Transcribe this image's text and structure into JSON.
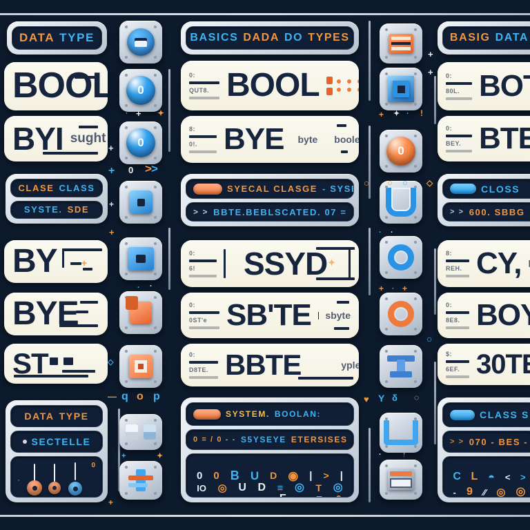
{
  "meta": {
    "background": "#0c1a2c",
    "accent_orange": "#f2973e",
    "accent_blue": "#3fb4f2",
    "plate_cream": "#faf8ee",
    "ink": "#16243d"
  },
  "columns": {
    "left": {
      "header": {
        "name": "data-type-header",
        "word1": "DATA",
        "word2": "TYPE"
      },
      "plates": [
        {
          "name": "bool-plate",
          "big": "BOOL",
          "ghost": "",
          "tiny": ""
        },
        {
          "name": "byte-plate",
          "big": "BYI",
          "ghost": "sught",
          "tiny": ""
        },
        {
          "name": "by-plate",
          "big": "BY",
          "ghost": "",
          "tiny": ""
        },
        {
          "name": "bye-plate",
          "big": "BYE",
          "ghost": "",
          "tiny": ""
        },
        {
          "name": "st-plate",
          "big": "ST",
          "ghost": "",
          "tiny": ""
        }
      ],
      "class_panel": {
        "name": "class-panel",
        "row1a": "CLASE",
        "row1b": "CLASS",
        "row2a": "SYSTE.",
        "row2b": "SDE"
      },
      "bottom_panel": {
        "name": "data-type-panel",
        "row1a": "DATA",
        "row1b": "TYPE",
        "row2": "SECTELLE"
      }
    },
    "middle": {
      "header": {
        "name": "basics-header",
        "w1": "BASICS",
        "w2": "DADA",
        "w3": "DO",
        "w4": "TYPES"
      },
      "plates": [
        {
          "name": "bool-row",
          "code": "0:",
          "sub": "QUT8.",
          "big": "BOOL",
          "ghost": ""
        },
        {
          "name": "bye-row",
          "code": "8:",
          "sub": "0!.",
          "big": "BYE",
          "ghost": "byte",
          "ghost2": "boolean"
        },
        {
          "name": "ssyd-row",
          "code": "0:",
          "sub": "6!",
          "big": "SSYD",
          "ghost": ""
        },
        {
          "name": "sbyte-row",
          "code": "0:",
          "sub": "0ST'e",
          "big": "SB'TE",
          "ghost": "sbyte"
        },
        {
          "name": "bbte-row",
          "code": "0:",
          "sub": "D8TE.",
          "big": "BBTE",
          "ghost": "yples"
        }
      ],
      "special_panel": {
        "name": "special-class-panel",
        "row1a": "SYECAL CLASGE",
        "row1b": "- SYSE",
        "row2": "BBTE.BEBLSCATED. 07  ="
      },
      "bottom_panel": {
        "name": "system-boolean-panel",
        "row1a": "SYSTEM.",
        "row1b": "BOOLAN:",
        "row2a": "0 = / 0 - -",
        "row2b": "S5YSEYE",
        "row2c": "ETERSISES",
        "glyphs": [
          "0",
          "0",
          "B",
          "U",
          "D",
          "0",
          "|",
          ">",
          "|",
          "|",
          "O",
          "0",
          "U",
          "D",
          "0",
          "T",
          "O",
          "+",
          "<",
          "F",
          "T",
          "0"
        ]
      }
    },
    "right": {
      "header": {
        "name": "basic-data-header",
        "word1": "BASIG",
        "word2": "DATA"
      },
      "plates": [
        {
          "name": "bot-plate",
          "code": "0:",
          "sub": "80L.",
          "big": "BOT,"
        },
        {
          "name": "bte-plate",
          "code": "0:",
          "sub": "BEY.",
          "big": "BTE,"
        },
        {
          "name": "cy-plate",
          "code": "8:",
          "sub": "REH.",
          "big": "CY,",
          "ghost": "D -"
        },
        {
          "name": "boy-plate",
          "code": "0:",
          "sub": "8E8.",
          "big": "BOY"
        },
        {
          "name": "bote-plate",
          "code": "$:",
          "sub": "6EF.",
          "big": "30TE"
        }
      ],
      "class_panel": {
        "name": "closs-panel",
        "row1": "CLOSS",
        "row2": "600. SBBG"
      },
      "bottom_panel": {
        "name": "class-s-panel",
        "row1": "CLASS  S",
        "row2": "070 - BES -",
        "glyphs": [
          "C",
          "L",
          "<",
          ">",
          "-",
          "9",
          "O",
          "O"
        ]
      }
    }
  },
  "icon_columns": {
    "left_strip": [
      {
        "name": "disc-stack-icon",
        "shape": "disc-lines",
        "color": "#2f8fe0"
      },
      {
        "name": "knob-zero-icon",
        "shape": "knob",
        "label": "0",
        "color": "#2f8fe0"
      },
      {
        "name": "knob-zero-icon-2",
        "shape": "knob",
        "label": "0",
        "color": "#2f8fe0"
      },
      {
        "name": "blue-square-icon",
        "shape": "square",
        "color": "#2f8fe0"
      },
      {
        "name": "blue-frame-icon",
        "shape": "frame",
        "color": "#2f8fe0"
      },
      {
        "name": "orange-square-icon",
        "shape": "square",
        "color": "#f2793e"
      },
      {
        "name": "orange-target-icon",
        "shape": "target",
        "color": "#f2793e"
      },
      {
        "name": "toggle-pair-icon",
        "shape": "pair",
        "color": "#cfd9e4"
      },
      {
        "name": "plus-blocks-icon",
        "shape": "plus",
        "color": "#3fb4f2"
      }
    ],
    "right_strip": [
      {
        "name": "orange-bars-icon",
        "shape": "bars",
        "color": "#f2793e"
      },
      {
        "name": "blue-nested-square-icon",
        "shape": "nested",
        "color": "#2f8fe0"
      },
      {
        "name": "orange-knob-icon",
        "shape": "knob",
        "label": "0",
        "color": "#f2793e"
      },
      {
        "name": "u-magnet-icon",
        "shape": "u",
        "color": "#2f8fe0"
      },
      {
        "name": "blue-ring-icon",
        "shape": "ring",
        "color": "#2f8fe0"
      },
      {
        "name": "orange-ring-icon",
        "shape": "ring",
        "color": "#f2793e"
      },
      {
        "name": "i-beam-icon",
        "shape": "ibeam",
        "color": "#3f7fd0"
      },
      {
        "name": "u-bracket-icon",
        "shape": "ubracket",
        "color": "#3fb4f2"
      },
      {
        "name": "drawer-icon",
        "shape": "drawer",
        "color": "#f2793e"
      }
    ]
  }
}
